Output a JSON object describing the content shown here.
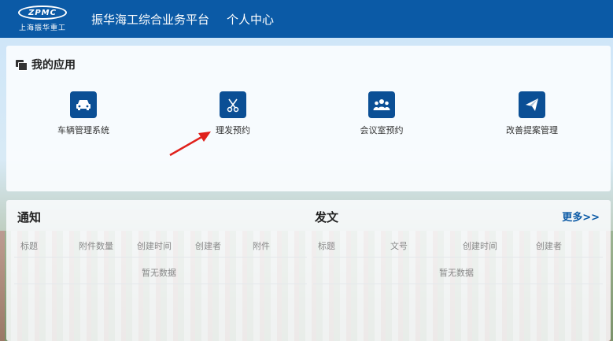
{
  "header": {
    "logo_text": "ZPMC",
    "logo_sub": "上海振华重工",
    "nav": [
      "振华海工综合业务平台",
      "个人中心"
    ]
  },
  "apps_section": {
    "title": "我的应用",
    "items": [
      {
        "label": "车辆管理系统",
        "icon": "car-icon"
      },
      {
        "label": "理发预约",
        "icon": "scissors-icon"
      },
      {
        "label": "会议室预约",
        "icon": "people-icon"
      },
      {
        "label": "改善提案管理",
        "icon": "paper-plane-icon"
      }
    ]
  },
  "notice": {
    "title": "通知",
    "columns": [
      "标题",
      "附件数量",
      "创建时间",
      "创建者",
      "附件"
    ],
    "empty_text": "暂无数据"
  },
  "documents": {
    "title": "发文",
    "more_label": "更多>>",
    "columns": [
      "标题",
      "文号",
      "创建时间",
      "创建者"
    ],
    "empty_text": "暂无数据"
  },
  "colors": {
    "header_bg": "#0b5aa6",
    "icon_bg": "#0b4f95",
    "arrow": "#e0201b"
  }
}
